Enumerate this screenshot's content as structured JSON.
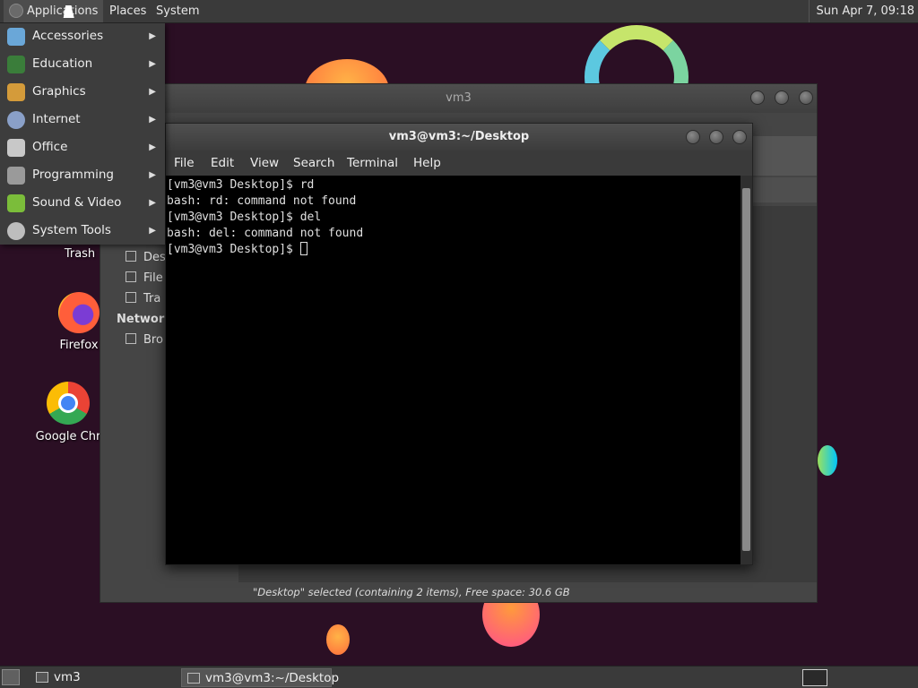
{
  "top_panel": {
    "menus": [
      "Applications",
      "Places",
      "System"
    ],
    "clock": "Sun Apr 7, 09:18"
  },
  "apps_menu": {
    "items": [
      {
        "label": "Accessories",
        "icon": "accessories-icon",
        "color": "#6aa7d8"
      },
      {
        "label": "Education",
        "icon": "education-icon",
        "color": "#3a7d3a"
      },
      {
        "label": "Graphics",
        "icon": "graphics-icon",
        "color": "#d49b3a"
      },
      {
        "label": "Internet",
        "icon": "internet-icon",
        "color": "#8aa0c8"
      },
      {
        "label": "Office",
        "icon": "office-icon",
        "color": "#c8c8c8"
      },
      {
        "label": "Programming",
        "icon": "programming-icon",
        "color": "#9a9a9a"
      },
      {
        "label": "Sound & Video",
        "icon": "sound-video-icon",
        "color": "#7bbd3a"
      },
      {
        "label": "System Tools",
        "icon": "system-tools-icon",
        "color": "#bdbdbd"
      }
    ]
  },
  "desktop_icons": {
    "trash": "Trash",
    "firefox": "Firefox",
    "chrome": "Google Chr"
  },
  "file_manager": {
    "title": "vm3",
    "sidebar": {
      "items": [
        "Des",
        "File",
        "Tra"
      ],
      "network_heading": "Network",
      "network_items": [
        "Bro"
      ]
    },
    "status": "\"Desktop\" selected (containing 2 items), Free space: 30.6 GB"
  },
  "terminal": {
    "title": "vm3@vm3:~/Desktop",
    "menu": [
      "File",
      "Edit",
      "View",
      "Search",
      "Terminal",
      "Help"
    ],
    "lines": [
      "[vm3@vm3 Desktop]$ rd",
      "bash: rd: command not found",
      "[vm3@vm3 Desktop]$ del",
      "bash: del: command not found",
      "[vm3@vm3 Desktop]$ "
    ]
  },
  "taskbar": {
    "tasks": [
      "vm3",
      "vm3@vm3:~/Desktop"
    ]
  }
}
